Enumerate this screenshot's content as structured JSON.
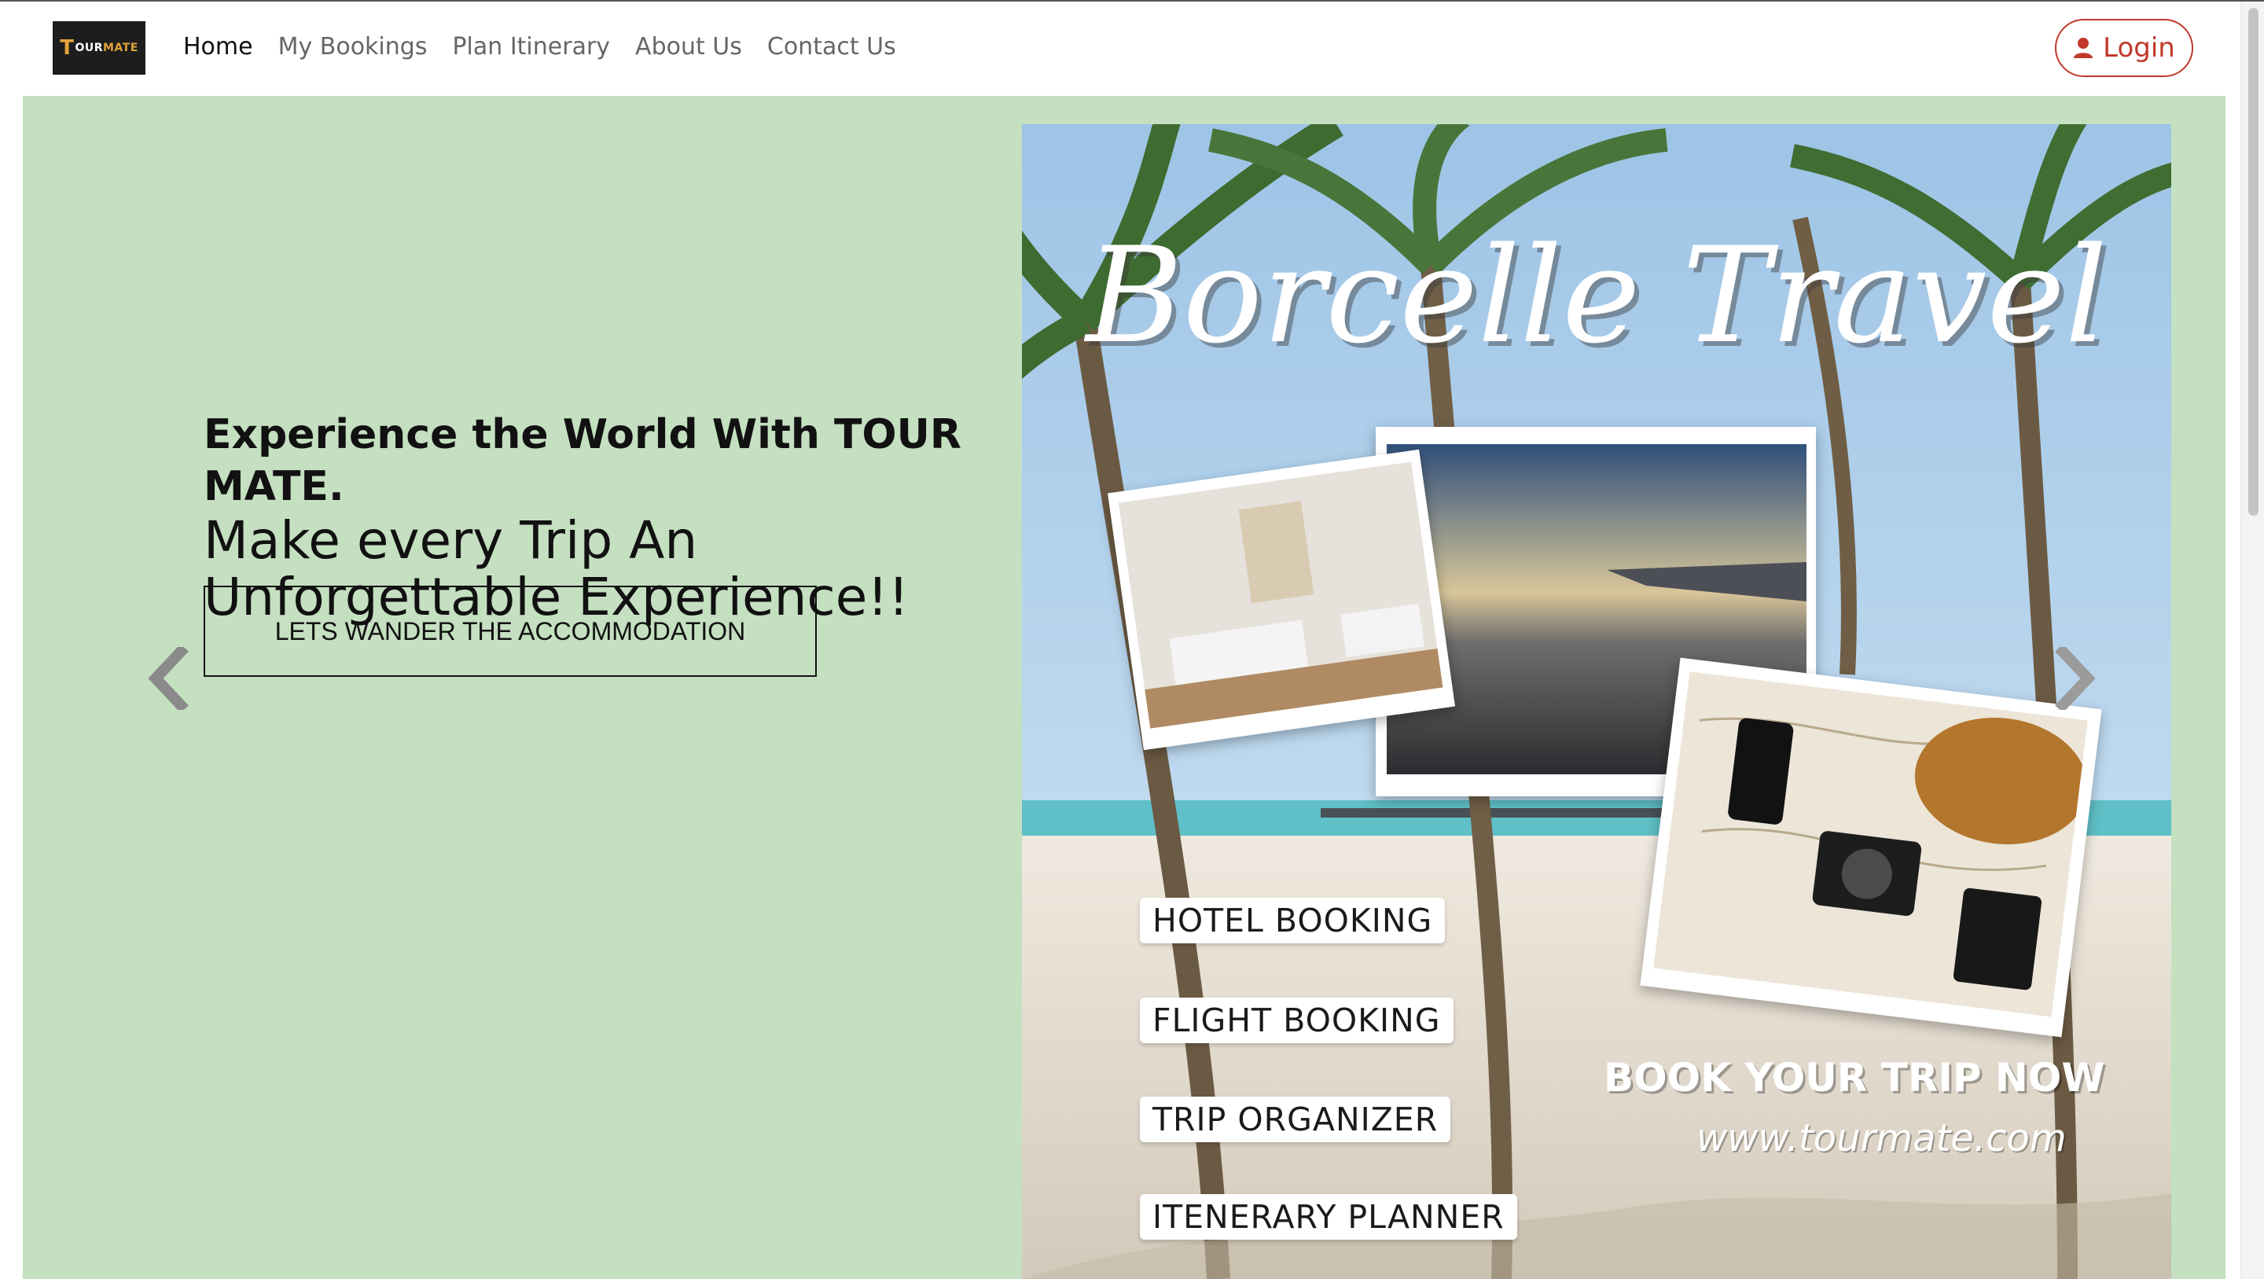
{
  "brand": {
    "logo_text_first": "T",
    "logo_text_rest": "OUR",
    "logo_text_mate": "MATE"
  },
  "nav": {
    "links": [
      "Home",
      "My Bookings",
      "Plan Itinerary",
      "About Us",
      "Contact Us"
    ],
    "active": "Home",
    "login_label": "Login"
  },
  "hero": {
    "headline": "Experience the World With TOUR MATE.",
    "subline": "Make every Trip An Unforgettable Experience!!",
    "cta_label": "LETS WANDER THE ACCOMMODATION",
    "prev_icon": "chevron-left-icon",
    "next_icon": "chevron-right-icon"
  },
  "poster": {
    "title": "Borcelle Travel",
    "services": [
      "HOTEL BOOKING",
      "FLIGHT BOOKING",
      "TRIP ORGANIZER",
      "ITENERARY PLANNER"
    ],
    "book_cta": "BOOK YOUR TRIP NOW",
    "website": "www.tourmate.com"
  },
  "colors": {
    "hero_background": "#c5dfc1",
    "login_accent": "#c0392b",
    "logo_background": "#1d1d1d"
  }
}
